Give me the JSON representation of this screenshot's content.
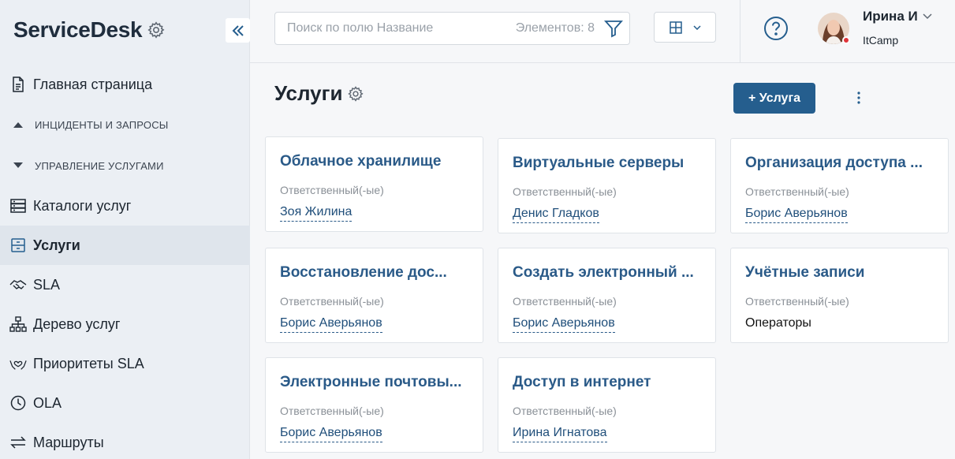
{
  "brand": {
    "title": "ServiceDesk"
  },
  "nav": {
    "home": "Главная страница",
    "section_incidents": "ИНЦИДЕНТЫ И ЗАПРОСЫ",
    "section_services": "УПРАВЛЕНИЕ УСЛУГАМИ",
    "catalogs": "Каталоги услуг",
    "services": "Услуги",
    "sla": "SLA",
    "tree": "Дерево услуг",
    "sla_priorities": "Приоритеты SLA",
    "ola": "OLA",
    "routes": "Маршруты"
  },
  "topbar": {
    "search_placeholder": "Поиск по полю Название",
    "count": "Элементов: 8",
    "user_name": "Ирина И",
    "user_org": "ItCamp"
  },
  "page": {
    "title": "Услуги",
    "add_button": "+ Услуга"
  },
  "cards": [
    {
      "title": "Облачное хранилище",
      "label": "Ответственный(-ые)",
      "value": "Зоя Жилина"
    },
    {
      "title": "Виртуальные серверы",
      "label": "Ответственный(-ые)",
      "value": "Денис Гладков"
    },
    {
      "title": "Организация доступа ...",
      "label": "Ответственный(-ые)",
      "value": "Борис Аверьянов"
    },
    {
      "title": "Восстановление дос...",
      "label": "Ответственный(-ые)",
      "value": "Борис Аверьянов"
    },
    {
      "title": "Создать электронный ...",
      "label": "Ответственный(-ые)",
      "value": "Борис Аверьянов"
    },
    {
      "title": "Учётные записи",
      "label": "Ответственный(-ые)",
      "value": "Операторы"
    },
    {
      "title": "Электронные почтовы...",
      "label": "Ответственный(-ые)",
      "value": "Борис Аверьянов"
    },
    {
      "title": "Доступ в интернет",
      "label": "Ответственный(-ые)",
      "value": "Ирина Игнатова"
    }
  ],
  "colors": {
    "accent": "#255e8e",
    "link": "#2a5a88",
    "sidebar_bg": "#ebeff4",
    "status_dot": "#e0343a"
  },
  "icons": {
    "brand_settings": "gear-icon",
    "collapse": "double-chevron-left-icon",
    "filter": "filter-icon",
    "view": "grid-view-icon",
    "help": "question-circle-icon",
    "more": "vertical-dots-icon"
  }
}
